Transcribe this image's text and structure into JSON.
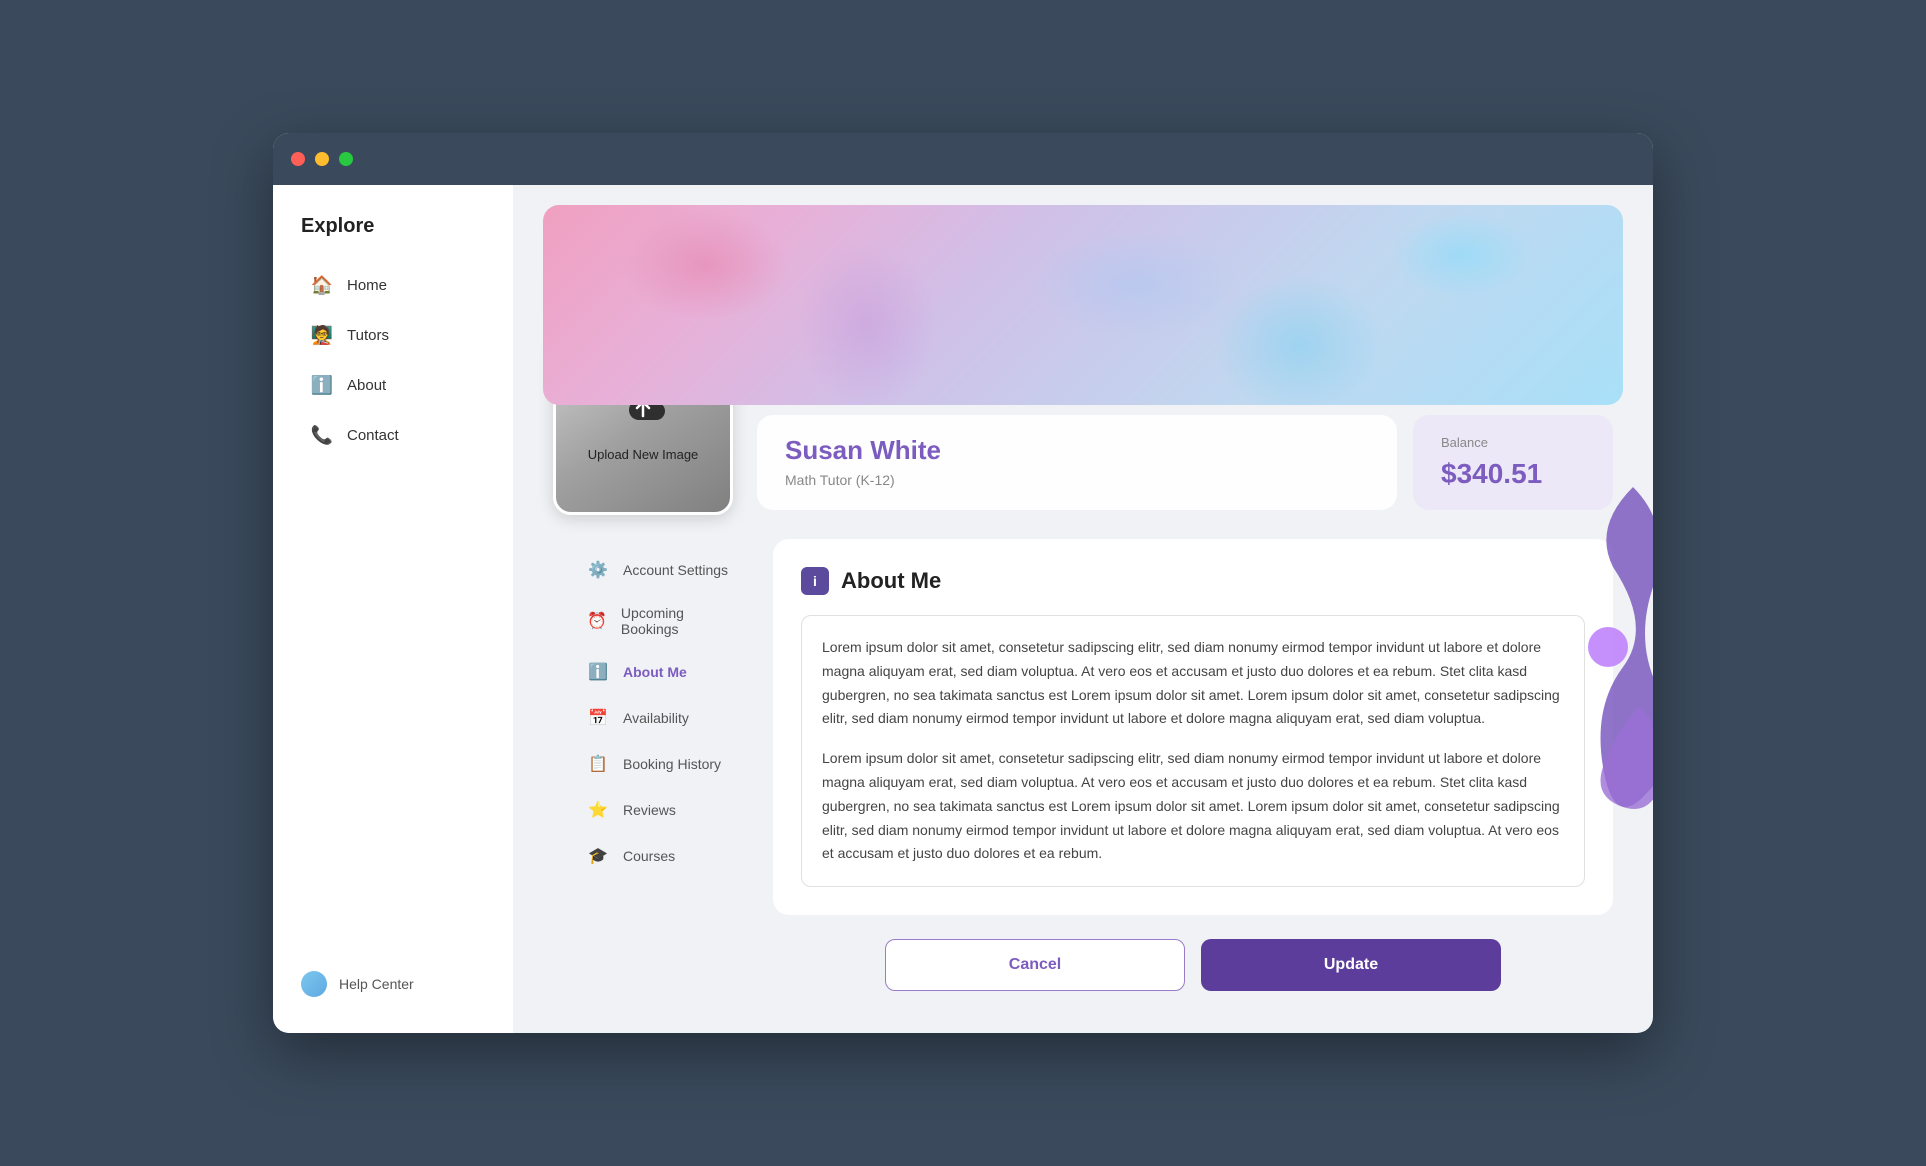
{
  "window": {
    "titlebar": {
      "dot_red": "close",
      "dot_yellow": "minimize",
      "dot_green": "maximize"
    }
  },
  "sidebar": {
    "title": "Explore",
    "items": [
      {
        "id": "home",
        "label": "Home",
        "icon": "🏠"
      },
      {
        "id": "tutors",
        "label": "Tutors",
        "icon": "🧑‍🏫"
      },
      {
        "id": "about",
        "label": "About",
        "icon": "ℹ️"
      },
      {
        "id": "contact",
        "label": "Contact",
        "icon": "📞"
      }
    ],
    "help": {
      "label": "Help Center"
    }
  },
  "profile": {
    "upload_label": "Upload New Image",
    "name": "Susan White",
    "role": "Math Tutor (K-12)",
    "balance_label": "Balance",
    "balance_amount": "$340.51"
  },
  "about_me": {
    "title": "About Me",
    "paragraphs": [
      "Lorem ipsum dolor sit amet, consetetur sadipscing elitr, sed diam nonumy eirmod tempor invidunt ut labore et dolore magna aliquyam erat, sed diam voluptua. At vero eos et accusam et justo duo dolores et ea rebum. Stet clita kasd gubergren, no sea takimata sanctus est Lorem ipsum dolor sit amet. Lorem ipsum dolor sit amet, consetetur sadipscing elitr, sed diam nonumy eirmod tempor invidunt ut labore et dolore magna aliquyam erat, sed diam voluptua.",
      "Lorem ipsum dolor sit amet, consetetur sadipscing elitr, sed diam nonumy eirmod tempor invidunt ut labore et dolore magna aliquyam erat, sed diam voluptua. At vero eos et accusam et justo duo dolores et ea rebum. Stet clita kasd gubergren, no sea takimata sanctus est Lorem ipsum dolor sit amet. Lorem ipsum dolor sit amet, consetetur sadipscing elitr, sed diam nonumy eirmod tempor invidunt ut labore et dolore magna aliquyam erat, sed diam voluptua. At vero eos et accusam et justo duo dolores et ea rebum."
    ]
  },
  "sub_nav": {
    "items": [
      {
        "id": "account-settings",
        "label": "Account Settings",
        "icon": "⚙️",
        "active": false
      },
      {
        "id": "upcoming-bookings",
        "label": "Upcoming Bookings",
        "icon": "⏰",
        "active": false
      },
      {
        "id": "about-me",
        "label": "About Me",
        "icon": "ℹ️",
        "active": true
      },
      {
        "id": "availability",
        "label": "Availability",
        "icon": "📅",
        "active": false
      },
      {
        "id": "booking-history",
        "label": "Booking History",
        "icon": "📋",
        "active": false
      },
      {
        "id": "reviews",
        "label": "Reviews",
        "icon": "⭐",
        "active": false
      },
      {
        "id": "courses",
        "label": "Courses",
        "icon": "🎓",
        "active": false
      }
    ]
  },
  "actions": {
    "cancel_label": "Cancel",
    "update_label": "Update"
  }
}
